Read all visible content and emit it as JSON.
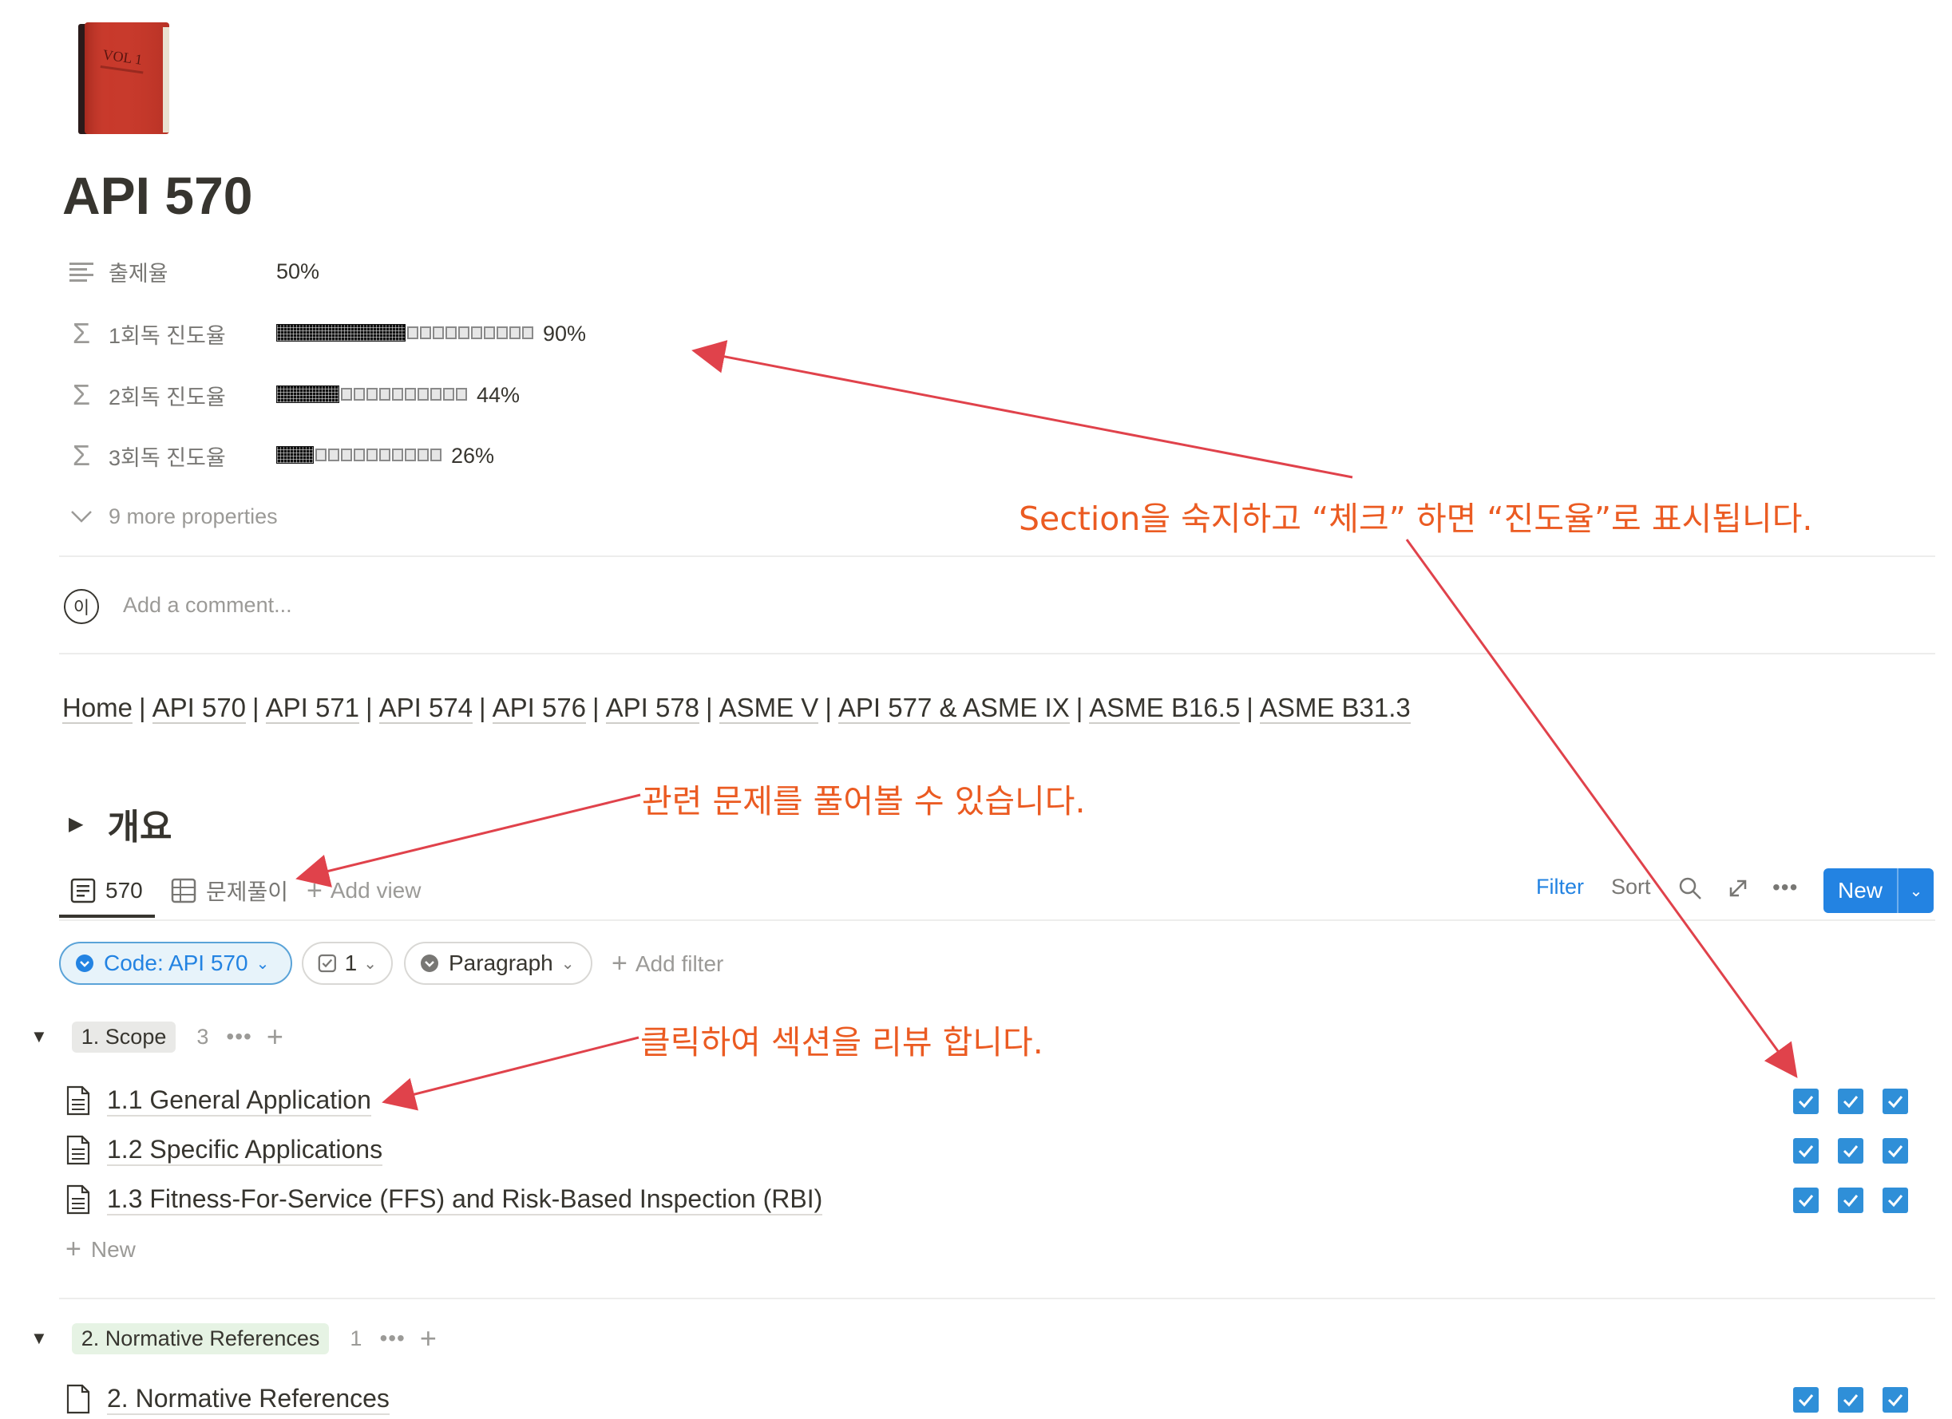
{
  "page": {
    "title": "API 570",
    "properties": [
      {
        "icon": "text-lines-icon",
        "label": "출제율",
        "value": "50%"
      },
      {
        "icon": "sigma-icon",
        "label": "1회독 진도율",
        "percent_text": "90%",
        "progress": 0.9
      },
      {
        "icon": "sigma-icon",
        "label": "2회독 진도율",
        "percent_text": "44%",
        "progress": 0.44
      },
      {
        "icon": "sigma-icon",
        "label": "3회독 진도율",
        "percent_text": "26%",
        "progress": 0.26
      }
    ],
    "more_properties": "9 more properties",
    "comment_avatar": "이",
    "comment_placeholder": "Add a comment..."
  },
  "nav_links": [
    "Home",
    "API 570",
    "API 571",
    "API 574",
    "API 576",
    "API 578",
    "ASME V",
    "API 577 & ASME IX",
    "ASME B16.5",
    "ASME B31.3"
  ],
  "nav_separator": "|",
  "annotations": {
    "progress": "Section을 숙지하고 “체크” 하면 “진도율”로 표시됩니다.",
    "questions": "관련 문제를 풀어볼 수 있습니다.",
    "review": "클릭하여 섹션을 리뷰 합니다."
  },
  "toggle_heading": "개요",
  "views": {
    "tabs": [
      {
        "label": "570",
        "icon": "page-icon"
      },
      {
        "label": "문제풀이",
        "icon": "table-icon"
      }
    ],
    "add_view": "Add view",
    "filter": "Filter",
    "sort": "Sort",
    "new_label": "New"
  },
  "filters": {
    "code": "Code: API 570",
    "checkbox": "1",
    "paragraph": "Paragraph",
    "add_filter": "Add filter"
  },
  "groups": [
    {
      "name": "1. Scope",
      "count": "3",
      "color": "#e9e9e7",
      "items": [
        {
          "title": "1.1 General Application",
          "checks": [
            true,
            true,
            true
          ]
        },
        {
          "title": "1.2 Specific Applications",
          "checks": [
            true,
            true,
            true
          ]
        },
        {
          "title": "1.3 Fitness-For-Service (FFS) and Risk-Based Inspection (RBI)",
          "checks": [
            true,
            true,
            true
          ]
        }
      ],
      "new_label": "New"
    },
    {
      "name": "2. Normative References",
      "count": "1",
      "color": "#e6f3e4",
      "items": [
        {
          "title": "2. Normative References",
          "checks": [
            true,
            true,
            true
          ]
        }
      ]
    }
  ],
  "colors": {
    "accent": "#2383e2",
    "annotation": "#eb5b22",
    "arrow": "#e0424b",
    "checkbox": "#2f8fd8"
  }
}
